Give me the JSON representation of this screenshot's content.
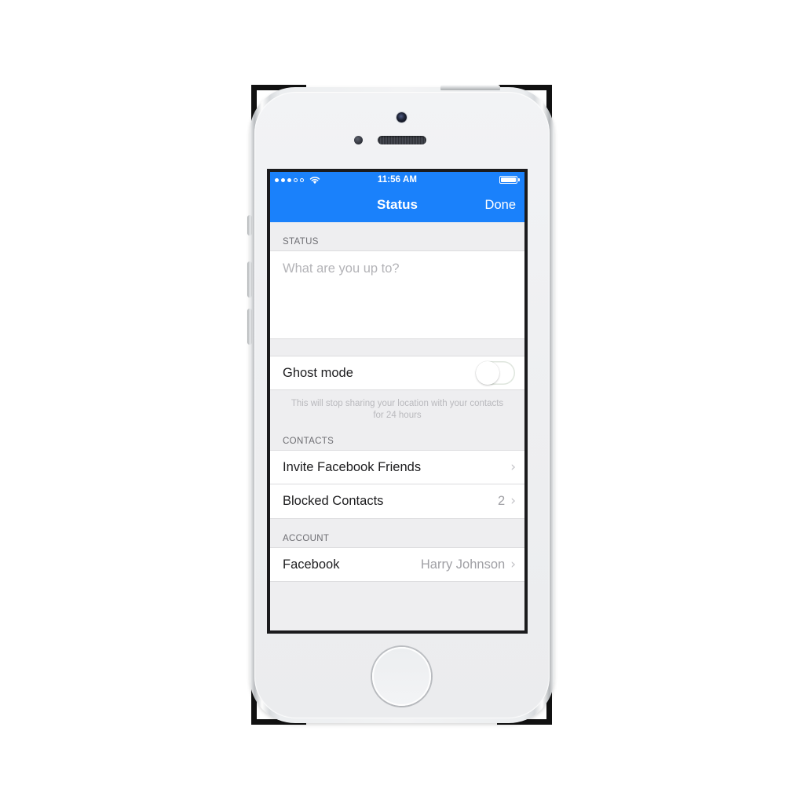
{
  "device": {
    "name": "iphone-5s-silver",
    "hardware": {
      "camera": "front-camera",
      "speaker": "earpiece-speaker",
      "proximity": "proximity-sensor",
      "home": "home-button",
      "power": "power-button",
      "volume_up": "volume-up-button",
      "volume_down": "volume-down-button",
      "silent": "silent-switch"
    }
  },
  "status_bar": {
    "signal_filled": 3,
    "signal_empty": 2,
    "wifi": "wifi-icon",
    "time": "11:56 AM",
    "battery_level": 100
  },
  "nav_bar": {
    "title": "Status",
    "done_label": "Done",
    "background_color": "#1a81fb"
  },
  "sections": {
    "status": {
      "header": "STATUS",
      "placeholder": "What are you up to?",
      "value": ""
    },
    "ghost": {
      "title": "Ghost mode",
      "enabled": false,
      "footer": "This will stop sharing your location with your contacts for 24 hours"
    },
    "contacts": {
      "header": "CONTACTS",
      "rows": [
        {
          "title": "Invite Facebook Friends",
          "value": "",
          "chevron": "›"
        },
        {
          "title": "Blocked Contacts",
          "value": "2",
          "chevron": "›"
        }
      ]
    },
    "account": {
      "header": "ACCOUNT",
      "rows": [
        {
          "title": "Facebook",
          "value": "Harry Johnson",
          "chevron": "›"
        }
      ]
    }
  }
}
